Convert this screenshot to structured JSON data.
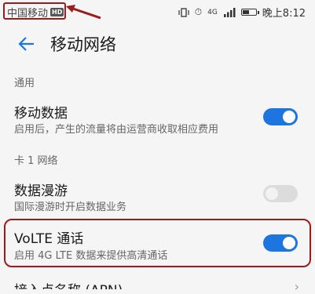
{
  "status_bar": {
    "carrier": "中国移动",
    "hd_badge": "HD",
    "network_label": "4G",
    "time": "晚上8:12",
    "battery_level": 0.6
  },
  "header": {
    "title": "移动网络"
  },
  "sections": {
    "general": "通用",
    "card1": "卡 1 网络"
  },
  "rows": {
    "mobile_data": {
      "title": "移动数据",
      "subtitle": "启用后，产生的流量将由运营商收取相应费用",
      "enabled": true
    },
    "data_roaming": {
      "title": "数据漫游",
      "subtitle": "国际漫游时开启数据业务",
      "enabled": false
    },
    "volte": {
      "title": "VoLTE 通话",
      "subtitle": "启用 4G LTE 数据来提供高清通话",
      "enabled": true
    },
    "apn": {
      "title": "接入点名称 (APN)"
    }
  },
  "colors": {
    "accent": "#1f75e0",
    "highlight": "#9b1c1c"
  }
}
